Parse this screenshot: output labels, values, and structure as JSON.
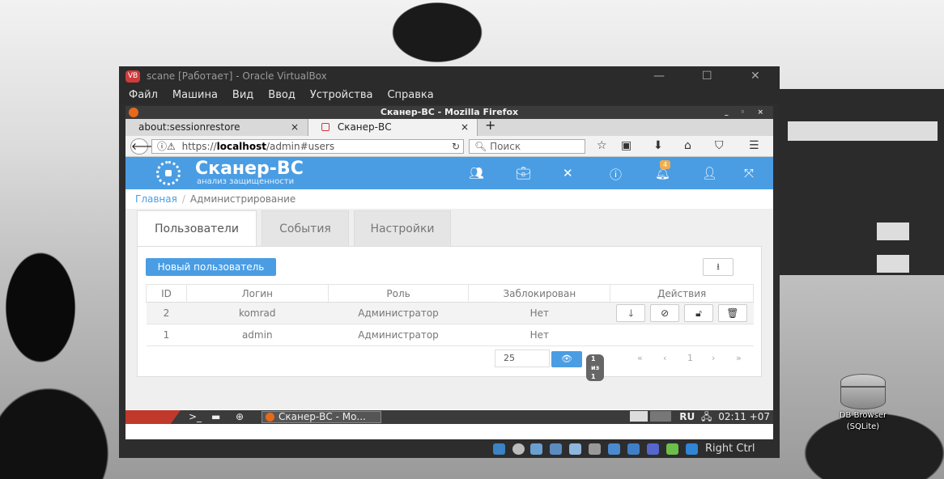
{
  "vbox": {
    "title": "scane [Работает] - Oracle VirtualBox",
    "menu": [
      "Файл",
      "Машина",
      "Вид",
      "Ввод",
      "Устройства",
      "Справка"
    ],
    "window_controls": {
      "minimize": "—",
      "maximize": "☐",
      "close": "✕"
    },
    "host_key": "Right Ctrl"
  },
  "firefox": {
    "title": "Сканер-ВС - Mozilla Firefox",
    "window_controls": "_ ◦ ×",
    "tabs": [
      {
        "label": "about:sessionrestore",
        "close": "×"
      },
      {
        "label": "Сканер-ВС",
        "close": "×"
      }
    ],
    "new_tab": "+",
    "url_host": "https://localhost",
    "url_host_prefix": "https://",
    "url_host_bold": "localhost",
    "url_path": "/admin#users",
    "search_placeholder": "Поиск"
  },
  "app": {
    "brand_title": "Сканер-ВС",
    "brand_subtitle": "анализ защищенности",
    "notification_count": "4",
    "accent_color": "#4a9de3"
  },
  "breadcrumb": {
    "home": "Главная",
    "separator": "/",
    "current": "Администрирование"
  },
  "page_tabs": [
    "Пользователи",
    "События",
    "Настройки"
  ],
  "toolbar": {
    "new_user_label": "Новый пользователь",
    "export_icon": "⭳"
  },
  "users_table": {
    "headers": [
      "ID",
      "Логин",
      "Роль",
      "Заблокирован",
      "Действия"
    ],
    "rows": [
      {
        "id": "2",
        "login": "komrad",
        "role": "Администратор",
        "blocked": "Нет"
      },
      {
        "id": "1",
        "login": "admin",
        "role": "Администратор",
        "blocked": "Нет"
      }
    ]
  },
  "pagination": {
    "page_size": "25",
    "info": "1 из 1",
    "first": "«",
    "prev": "‹",
    "page": "1",
    "next": "›",
    "last": "»"
  },
  "guest_taskbar": {
    "terminal": ">_",
    "task_label": "Сканер-ВС - Мо...",
    "lang": "RU",
    "clock": "02:11 +07"
  },
  "desktop_icon": {
    "label_line1": "DB Browser",
    "label_line2": "(SQLite)"
  }
}
